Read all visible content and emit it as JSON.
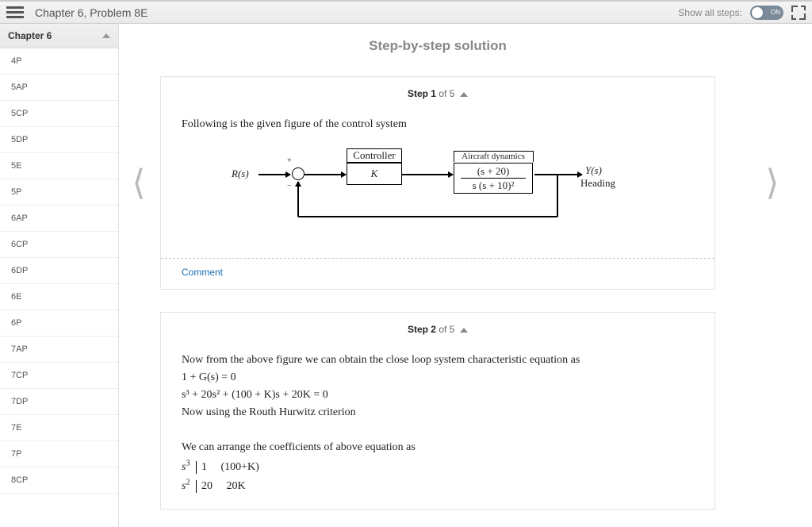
{
  "header": {
    "breadcrumb": "Chapter 6, Problem 8E",
    "show_all_steps_label": "Show all steps:",
    "toggle_state": "ON"
  },
  "sidebar": {
    "chapter_label": "Chapter 6",
    "items": [
      "4P",
      "5AP",
      "5CP",
      "5DP",
      "5E",
      "5P",
      "6AP",
      "6CP",
      "6DP",
      "6E",
      "6P",
      "7AP",
      "7CP",
      "7DP",
      "7E",
      "7P",
      "8CP"
    ]
  },
  "solution": {
    "title": "Step-by-step solution",
    "steps": [
      {
        "label_strong": "Step 1",
        "label_rest": " of 5",
        "intro": "Following is the given figure of the control system",
        "diagram": {
          "input": "R(s)",
          "controller_label": "Controller",
          "controller_val": "K",
          "plant_label": "Aircraft dynamics",
          "plant_num": "(s + 20)",
          "plant_den": "s (s + 10)²",
          "output": "Y(s)",
          "output_sub": "Heading",
          "sum_plus": "+",
          "sum_minus": "−"
        },
        "comment": "Comment"
      },
      {
        "label_strong": "Step 2",
        "label_rest": " of 5",
        "lines": [
          "Now from the above figure we can obtain the close loop system characteristic equation as",
          "1 + G(s) = 0",
          "s³ + 20s² + (100 + K)s + 20K = 0",
          "Now using the Routh Hurwitz criterion",
          "",
          "We can arrange the coefficients of above equation as"
        ],
        "routh": [
          {
            "power": "s³",
            "c1": "1",
            "c2": "(100+K)"
          },
          {
            "power": "s²",
            "c1": "20",
            "c2": "20K"
          }
        ]
      }
    ]
  }
}
